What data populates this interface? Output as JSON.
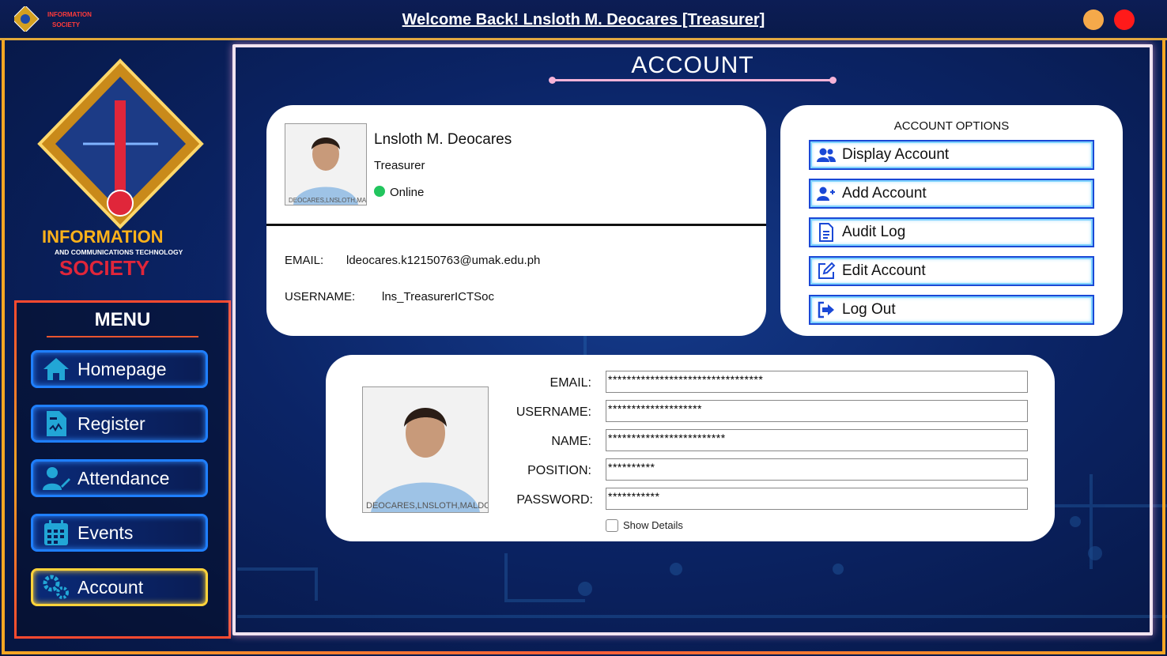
{
  "window": {
    "title": "Welcome Back! Lnsloth M. Deocares [Treasurer]",
    "minimize_color": "#f5a94a",
    "close_color": "#ff1a1a"
  },
  "sidebar": {
    "menu_title": "MENU",
    "logo_text": [
      "INFORMATION",
      "AND COMMUNICATIONS TECHNOLOGY",
      "SOCIETY"
    ],
    "items": [
      {
        "label": "Homepage",
        "icon": "home-icon"
      },
      {
        "label": "Register",
        "icon": "document-icon"
      },
      {
        "label": "Attendance",
        "icon": "user-edit-icon"
      },
      {
        "label": "Events",
        "icon": "calendar-icon"
      },
      {
        "label": "Account",
        "icon": "gears-icon",
        "active": true
      }
    ]
  },
  "page": {
    "title": "ACCOUNT"
  },
  "profile": {
    "name": "Lnsloth M. Deocares",
    "position": "Treasurer",
    "status": "Online",
    "email_label": "EMAIL:",
    "email": "ldeocares.k12150763@umak.edu.ph",
    "username_label": "USERNAME:",
    "username": "lns_TreasurerICTSoc",
    "photo_caption": "DEOCARES,LNSLOTH,MALDO"
  },
  "account_options": {
    "title": "ACCOUNT OPTIONS",
    "buttons": [
      {
        "label": "Display Account",
        "icon": "users-icon"
      },
      {
        "label": "Add Account",
        "icon": "user-plus-icon"
      },
      {
        "label": "Audit Log",
        "icon": "file-text-icon"
      },
      {
        "label": "Edit Account",
        "icon": "edit-icon"
      },
      {
        "label": "Log Out",
        "icon": "logout-icon"
      }
    ]
  },
  "details": {
    "fields": [
      {
        "label": "EMAIL:",
        "value": "*********************************"
      },
      {
        "label": "USERNAME:",
        "value": "********************"
      },
      {
        "label": "NAME:",
        "value": "*************************"
      },
      {
        "label": "POSITION:",
        "value": "**********"
      },
      {
        "label": "PASSWORD:",
        "value": "***********"
      }
    ],
    "show_details_label": "Show Details",
    "show_details_checked": false,
    "photo_caption": "DEOCARES,LNSLOTH,MALDO"
  },
  "colors": {
    "accent_blue": "#1f7fff",
    "active_gold": "#ffd33a",
    "online_green": "#22c55e"
  }
}
